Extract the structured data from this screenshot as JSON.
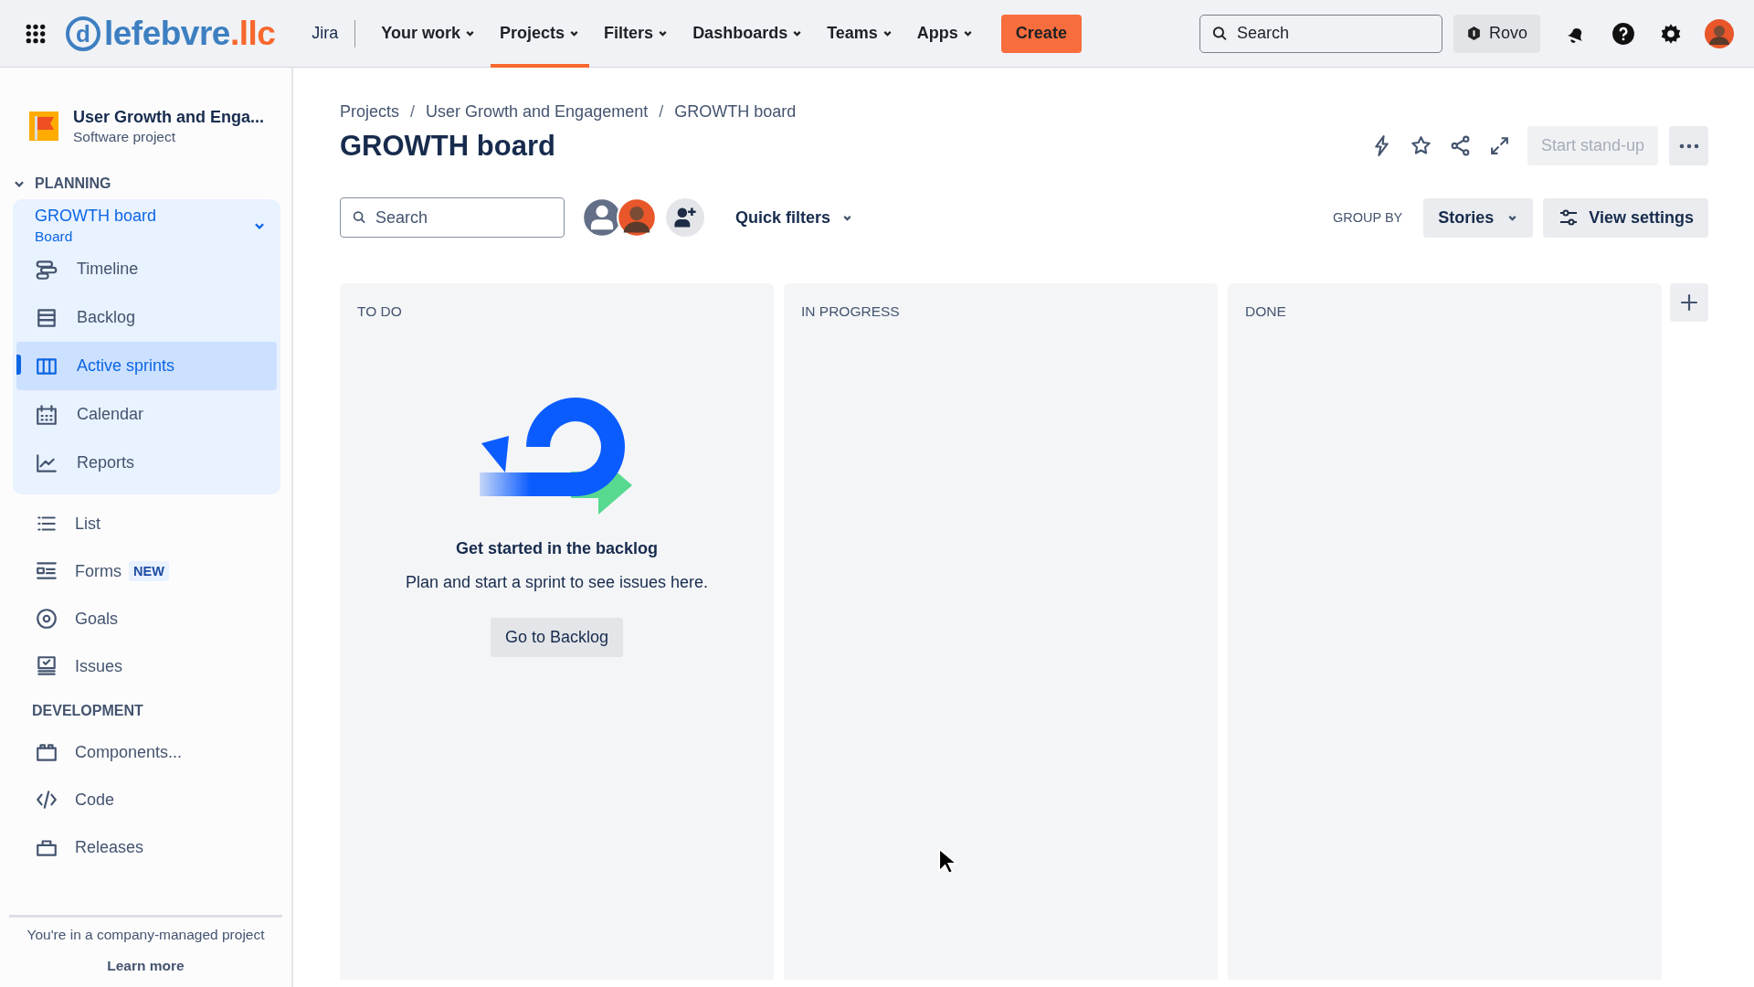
{
  "topbar": {
    "logo": {
      "mark": "d",
      "name": "lefebvre",
      "suffix": ".llc"
    },
    "product": "Jira",
    "nav": [
      {
        "label": "Your work",
        "selected": false
      },
      {
        "label": "Projects",
        "selected": true
      },
      {
        "label": "Filters",
        "selected": false
      },
      {
        "label": "Dashboards",
        "selected": false
      },
      {
        "label": "Teams",
        "selected": false
      },
      {
        "label": "Apps",
        "selected": false
      }
    ],
    "create": "Create",
    "search": {
      "placeholder": "Search"
    },
    "rovo": "Rovo"
  },
  "sidebar": {
    "project": {
      "name": "User Growth and Enga...",
      "type": "Software project"
    },
    "planning": {
      "title": "PLANNING",
      "expanded": true,
      "board": {
        "name": "GROWTH board",
        "type": "Board",
        "expanded": true
      },
      "items": [
        {
          "label": "Timeline",
          "kind": "timeline",
          "selected": false
        },
        {
          "label": "Backlog",
          "kind": "backlog",
          "selected": false
        },
        {
          "label": "Active sprints",
          "kind": "board",
          "selected": true
        },
        {
          "label": "Calendar",
          "kind": "calendar",
          "selected": false
        },
        {
          "label": "Reports",
          "kind": "reports",
          "selected": false
        }
      ]
    },
    "items": [
      {
        "label": "List",
        "kind": "list"
      },
      {
        "label": "Forms",
        "kind": "forms",
        "badge": "NEW"
      },
      {
        "label": "Goals",
        "kind": "goals"
      },
      {
        "label": "Issues",
        "kind": "issues"
      }
    ],
    "development": {
      "title": "DEVELOPMENT",
      "items": [
        {
          "label": "Components...",
          "kind": "components"
        },
        {
          "label": "Code",
          "kind": "code"
        },
        {
          "label": "Releases",
          "kind": "releases"
        }
      ]
    },
    "footer": {
      "text": "You're in a company-managed project",
      "link": "Learn more"
    }
  },
  "main": {
    "breadcrumbs": [
      {
        "label": "Projects",
        "separator": "/"
      },
      {
        "label": "User Growth and Engagement",
        "separator": "/"
      },
      {
        "label": "GROWTH board"
      }
    ],
    "title": "GROWTH board",
    "standup": {
      "label": "Start stand-up",
      "disabled": true
    },
    "search": {
      "placeholder": "Search"
    },
    "avatars": [
      {
        "kind": "default"
      },
      {
        "kind": "photo"
      }
    ],
    "quick_filters": "Quick filters",
    "group_by": {
      "label": "GROUP BY",
      "value": "Stories"
    },
    "view_settings": "View settings",
    "columns": [
      {
        "title": "TO DO",
        "empty_state": {
          "heading": "Get started in the backlog",
          "text": "Plan and start a sprint to see issues here.",
          "button": "Go to Backlog"
        }
      },
      {
        "title": "IN PROGRESS"
      },
      {
        "title": "DONE"
      }
    ]
  }
}
